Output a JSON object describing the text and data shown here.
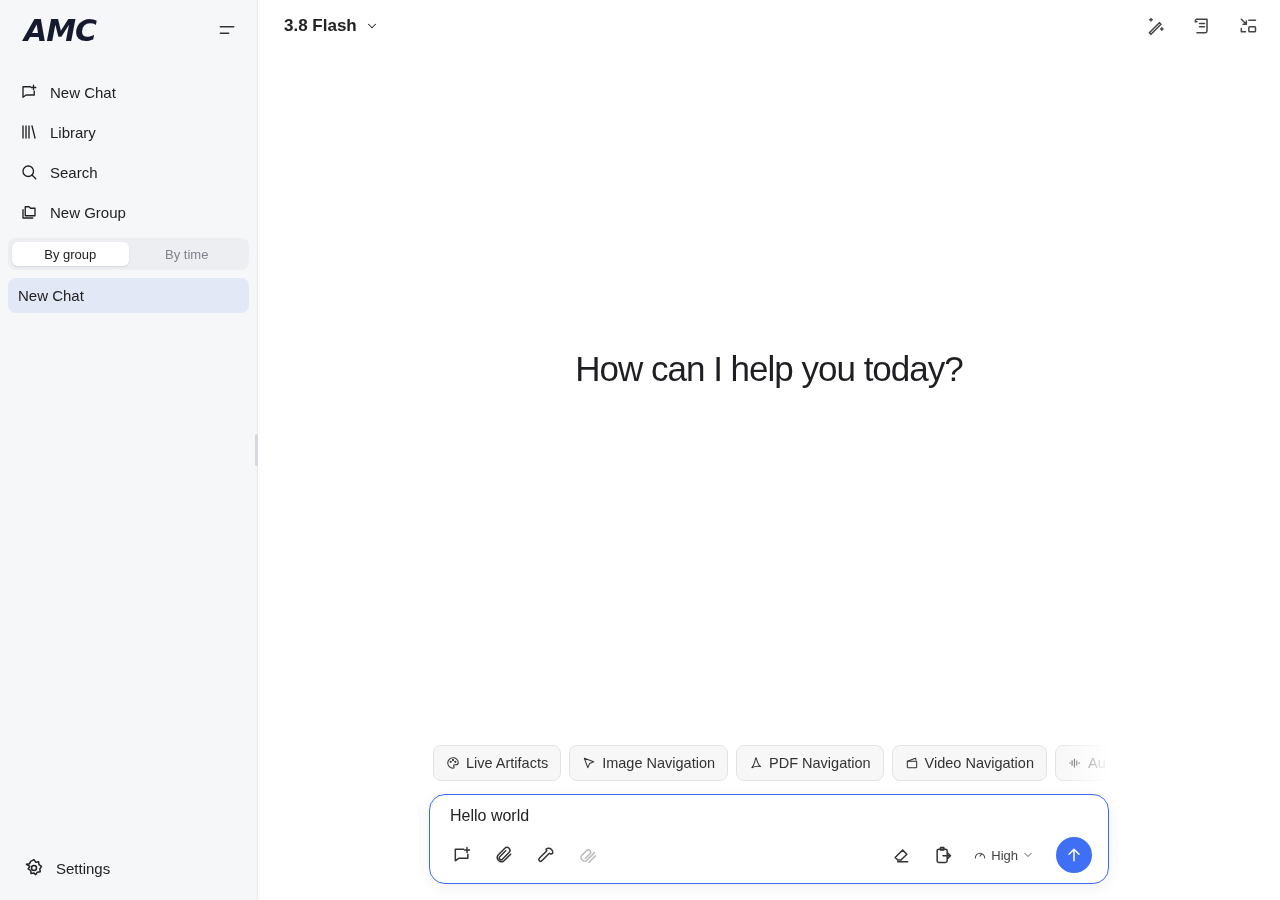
{
  "sidebar": {
    "logo": "AMC",
    "nav": [
      {
        "label": "New Chat"
      },
      {
        "label": "Library"
      },
      {
        "label": "Search"
      },
      {
        "label": "New Group"
      }
    ],
    "view_toggle": [
      {
        "label": "By group",
        "selected": true
      },
      {
        "label": "By time",
        "selected": false
      }
    ],
    "chats": [
      {
        "label": "New Chat",
        "selected": true
      }
    ],
    "settings": "Settings"
  },
  "header": {
    "model": "3.8 Flash"
  },
  "greeting": "How can I help you today?",
  "chips": [
    {
      "label": "Live Artifacts"
    },
    {
      "label": "Image Navigation"
    },
    {
      "label": "PDF Navigation"
    },
    {
      "label": "Video Navigation"
    },
    {
      "label": "Au"
    }
  ],
  "composer": {
    "value": "Hello world",
    "tools": [
      {
        "disabled": false
      },
      {
        "disabled": false
      },
      {
        "disabled": false
      },
      {
        "disabled": true
      }
    ],
    "effort": "High"
  }
}
